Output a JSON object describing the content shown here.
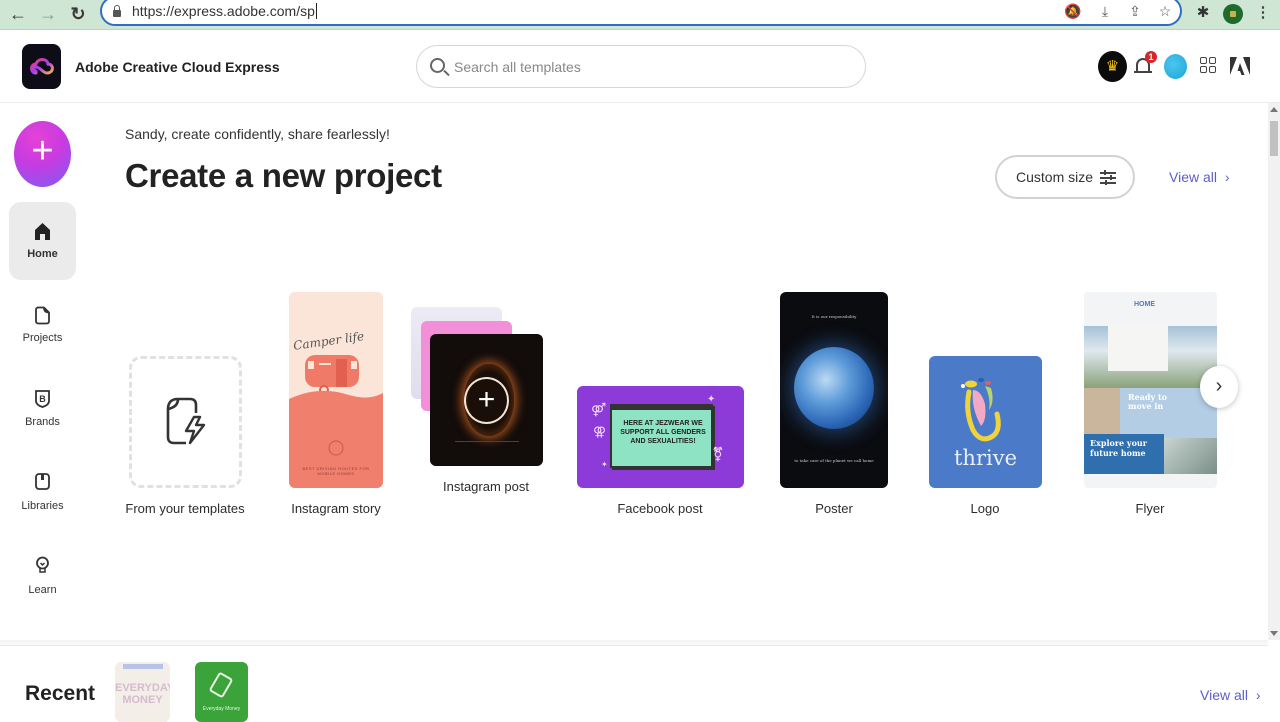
{
  "browser": {
    "url": "https://express.adobe.com/sp",
    "nav": {
      "back": "←",
      "forward": "→",
      "reload": "↻"
    }
  },
  "header": {
    "app_title": "Adobe Creative Cloud Express",
    "search_placeholder": "Search all templates",
    "search_value": "",
    "notification_count": "1",
    "icons": [
      "premium-crown-icon",
      "bell-icon",
      "user-avatar",
      "apps-grid-icon",
      "adobe-logo-icon"
    ]
  },
  "sidebar": {
    "create_label": "+",
    "items": [
      {
        "label": "Home",
        "icon": "home-icon",
        "active": true
      },
      {
        "label": "Projects",
        "icon": "document-icon",
        "active": false
      },
      {
        "label": "Brands",
        "icon": "brand-shield-icon",
        "active": false
      },
      {
        "label": "Libraries",
        "icon": "library-icon",
        "active": false
      },
      {
        "label": "Learn",
        "icon": "lightbulb-icon",
        "active": false
      }
    ]
  },
  "main": {
    "greeting": "Sandy, create confidently, share fearlessly!",
    "title": "Create a new project",
    "custom_size_label": "Custom size",
    "view_all_label": "View all",
    "view_all_chevron": "›",
    "templates": [
      {
        "label": "From your templates"
      },
      {
        "label": "Instagram story",
        "thumb_text": "Camper life",
        "thumb_subtext": "BEST DRIVING ROUTES FOR MOBILE HOMES"
      },
      {
        "label": "Instagram post",
        "thumb_text": "+"
      },
      {
        "label": "Facebook post",
        "thumb_text": "HERE AT JEZWEAR WE SUPPORT ALL GENDERS AND SEXUALITIES!"
      },
      {
        "label": "Poster",
        "thumb_text": "It is our responsibility",
        "thumb_subtext": "to take care of the planet we call home"
      },
      {
        "label": "Logo",
        "thumb_text": "thrive"
      },
      {
        "label": "Flyer",
        "thumb_text": "Ready to move in",
        "thumb_subtext": "Explore your future home",
        "thumb_brand": "HOME"
      }
    ],
    "next_label": "›"
  },
  "recent": {
    "title": "Recent",
    "view_all_label": "View all",
    "view_all_chevron": "›",
    "items": [
      {
        "thumb_text": "EVERYDAY MONEY"
      },
      {
        "thumb_text": "Everyday Money"
      }
    ]
  },
  "colors": {
    "accent": "#5b5fc7",
    "create_gradient_start": "#e542d6",
    "create_gradient_end": "#7b5df5",
    "badge": "#d7262b"
  }
}
